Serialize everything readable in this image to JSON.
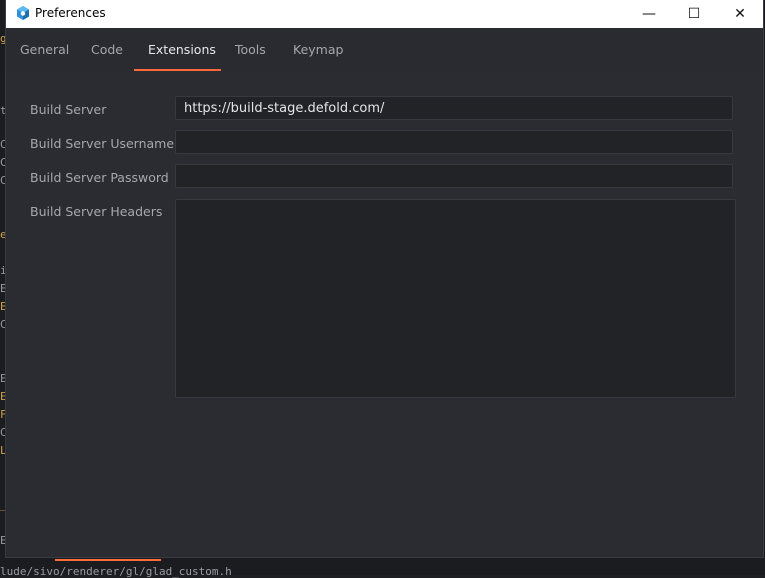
{
  "window": {
    "title": "Preferences",
    "min_glyph": "—",
    "max_glyph": "☐",
    "close_glyph": "✕"
  },
  "tabs": [
    {
      "label": "General",
      "active": false
    },
    {
      "label": "Code",
      "active": false
    },
    {
      "label": "Extensions",
      "active": true
    },
    {
      "label": "Tools",
      "active": false
    },
    {
      "label": "Keymap",
      "active": false
    }
  ],
  "fields": {
    "build_server": {
      "label": "Build Server",
      "value": "https://build-stage.defold.com/"
    },
    "username": {
      "label": "Build Server Username",
      "value": ""
    },
    "password": {
      "label": "Build Server Password",
      "value": ""
    },
    "headers": {
      "label": "Build Server Headers",
      "value": ""
    }
  },
  "background": {
    "bottom_path": "lude/sivo/renderer/gl/glad_custom.h",
    "accent_color": "#ff6a3d"
  }
}
